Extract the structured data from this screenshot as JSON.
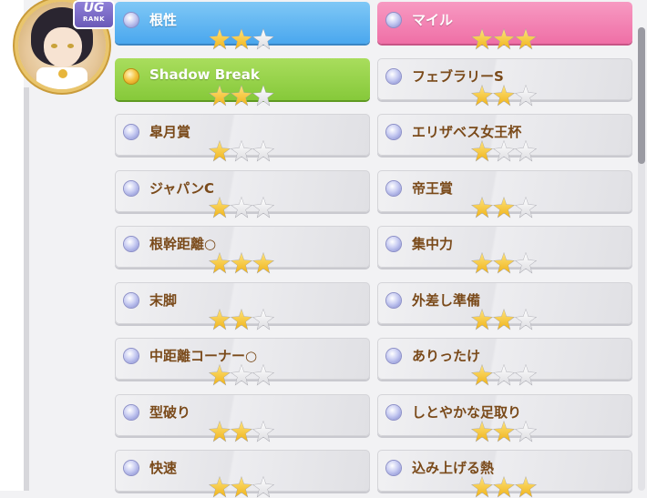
{
  "badge": {
    "line1": "UG",
    "line2": "RANK"
  },
  "skills": [
    {
      "name": "根性",
      "stars": 2,
      "max": 3,
      "style": "blue",
      "orb": "blue-orb-icon"
    },
    {
      "name": "マイル",
      "stars": 3,
      "max": 3,
      "style": "pink",
      "orb": "blue-orb-icon"
    },
    {
      "name": "Shadow Break",
      "stars": 2,
      "max": 3,
      "style": "green",
      "orb": "gold-orb-icon"
    },
    {
      "name": "フェブラリーS",
      "stars": 2,
      "max": 3,
      "style": "grey",
      "orb": "blue-orb-icon"
    },
    {
      "name": "皐月賞",
      "stars": 1,
      "max": 3,
      "style": "grey",
      "orb": "blue-orb-icon"
    },
    {
      "name": "エリザベス女王杯",
      "stars": 1,
      "max": 3,
      "style": "grey",
      "orb": "blue-orb-icon"
    },
    {
      "name": "ジャパンC",
      "stars": 1,
      "max": 3,
      "style": "grey",
      "orb": "blue-orb-icon"
    },
    {
      "name": "帝王賞",
      "stars": 2,
      "max": 3,
      "style": "grey",
      "orb": "blue-orb-icon"
    },
    {
      "name": "根幹距離○",
      "stars": 3,
      "max": 3,
      "style": "grey",
      "orb": "blue-orb-icon"
    },
    {
      "name": "集中力",
      "stars": 2,
      "max": 3,
      "style": "grey",
      "orb": "blue-orb-icon"
    },
    {
      "name": "末脚",
      "stars": 2,
      "max": 3,
      "style": "grey",
      "orb": "blue-orb-icon"
    },
    {
      "name": "外差し準備",
      "stars": 2,
      "max": 3,
      "style": "grey",
      "orb": "blue-orb-icon"
    },
    {
      "name": "中距離コーナー○",
      "stars": 1,
      "max": 3,
      "style": "grey",
      "orb": "blue-orb-icon"
    },
    {
      "name": "ありったけ",
      "stars": 1,
      "max": 3,
      "style": "grey",
      "orb": "blue-orb-icon"
    },
    {
      "name": "型破り",
      "stars": 2,
      "max": 3,
      "style": "grey",
      "orb": "blue-orb-icon"
    },
    {
      "name": "しとやかな足取り",
      "stars": 2,
      "max": 3,
      "style": "grey",
      "orb": "blue-orb-icon"
    },
    {
      "name": "快速",
      "stars": 2,
      "max": 3,
      "style": "grey",
      "orb": "blue-orb-icon"
    },
    {
      "name": "込み上げる熱",
      "stars": 3,
      "max": 3,
      "style": "grey",
      "orb": "blue-orb-icon"
    }
  ],
  "colors": {
    "star_on": "#f0b31a",
    "star_off": "#dcdce0",
    "label_brown": "#7a4a1a"
  }
}
